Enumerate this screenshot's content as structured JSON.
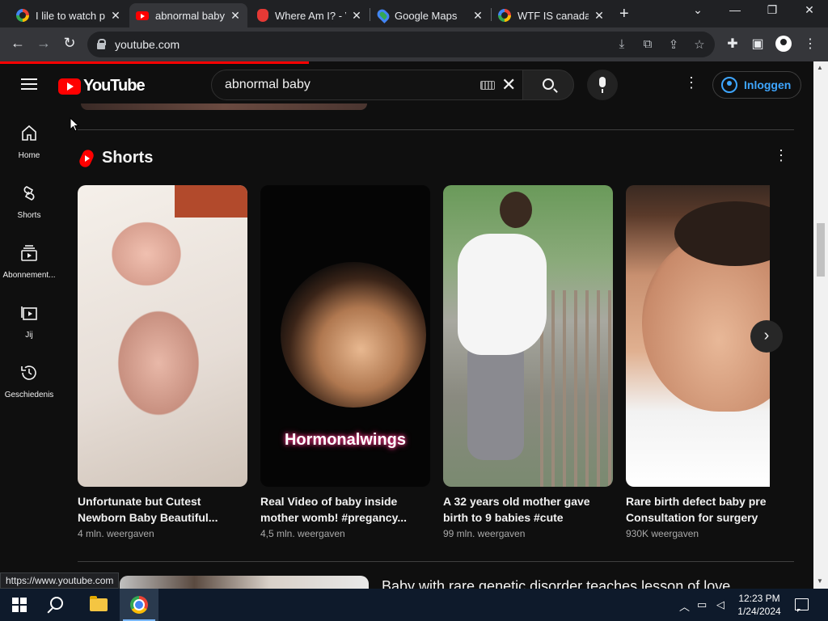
{
  "browser": {
    "tabs": [
      {
        "title": "I lile to watch p",
        "favicon": "google-icon",
        "active": false
      },
      {
        "title": "abnormal baby",
        "favicon": "youtube-icon",
        "active": true
      },
      {
        "title": "Where Am I? - V",
        "favicon": "shield-icon",
        "active": false
      },
      {
        "title": "Google Maps",
        "favicon": "maps-icon",
        "active": false
      },
      {
        "title": "WTF IS canada",
        "favicon": "google-icon",
        "active": false
      }
    ],
    "new_tab_symbol": "+",
    "window_controls": {
      "dropdown": "⌄",
      "minimize": "—",
      "restore": "❐",
      "close": "✕"
    },
    "url": "youtube.com",
    "status_url": "https://www.youtube.com"
  },
  "youtube": {
    "logo_text": "YouTube",
    "search_query": "abnormal baby",
    "signin_label": "Inloggen",
    "guide": [
      {
        "label": "Home",
        "icon": "home-icon"
      },
      {
        "label": "Shorts",
        "icon": "shorts-icon"
      },
      {
        "label": "Abonnement...",
        "icon": "subscriptions-icon"
      },
      {
        "label": "Jij",
        "icon": "you-icon"
      },
      {
        "label": "Geschiedenis",
        "icon": "history-icon"
      }
    ],
    "shorts": {
      "title": "Shorts",
      "items": [
        {
          "title": "Unfortunate but Cutest Newborn Baby Beautiful...",
          "views": "4 mln. weergaven"
        },
        {
          "title": "Real Video of baby inside mother womb! #pregancy...",
          "views": "4,5 mln. weergaven",
          "overlay_text": "Hormonalwings"
        },
        {
          "title": "A 32 years old mother gave birth to 9 babies #cute",
          "views": "99 mln. weergaven"
        },
        {
          "title": "Rare birth defect baby pre Consultation for surgery",
          "views": "930K weergaven"
        }
      ]
    },
    "next_video_title": "Baby with rare genetic disorder teaches lesson of love"
  },
  "taskbar": {
    "time": "12:23 PM",
    "date": "1/24/2024"
  },
  "colors": {
    "accent_red": "#ff0000",
    "link_blue": "#3ea6ff",
    "background": "#0f0f0f"
  }
}
